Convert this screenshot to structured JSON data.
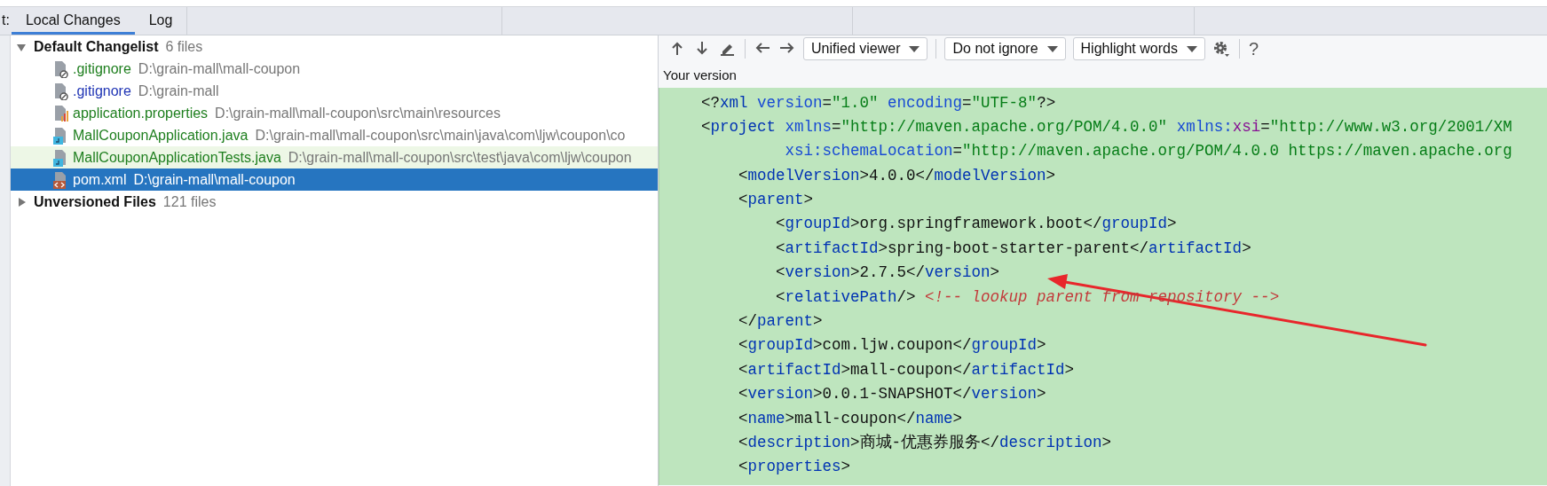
{
  "side_label": "t:",
  "tabs": [
    {
      "label": "Local Changes",
      "selected": true
    },
    {
      "label": "Log",
      "selected": false
    }
  ],
  "tree": [
    {
      "label": "Default Changelist",
      "count": "6 files",
      "expanded": true,
      "children": [
        {
          "name": ".gitignore",
          "path": "D:\\grain-mall\\mall-coupon",
          "kind": "ignore",
          "color": "#1f7f1f",
          "selected": false,
          "highlighted": false
        },
        {
          "name": ".gitignore",
          "path": "D:\\grain-mall",
          "kind": "ignore",
          "color": "#2035b5",
          "selected": false,
          "highlighted": false
        },
        {
          "name": "application.properties",
          "path": "D:\\grain-mall\\mall-coupon\\src\\main\\resources",
          "kind": "properties",
          "color": "#1f7f1f",
          "selected": false,
          "highlighted": false
        },
        {
          "name": "MallCouponApplication.java",
          "path": "D:\\grain-mall\\mall-coupon\\src\\main\\java\\com\\ljw\\coupon\\co",
          "kind": "java",
          "color": "#1f7f1f",
          "selected": false,
          "highlighted": false
        },
        {
          "name": "MallCouponApplicationTests.java",
          "path": "D:\\grain-mall\\mall-coupon\\src\\test\\java\\com\\ljw\\coupon",
          "kind": "java",
          "color": "#1f7f1f",
          "selected": false,
          "highlighted": true
        },
        {
          "name": "pom.xml",
          "path": "D:\\grain-mall\\mall-coupon",
          "kind": "xml",
          "selected": true,
          "highlighted": false
        }
      ]
    },
    {
      "label": "Unversioned Files",
      "count": "121 files",
      "expanded": false
    }
  ],
  "toolbar": [
    {
      "kind": "up"
    },
    {
      "kind": "down"
    },
    {
      "kind": "edit"
    },
    {
      "kind": "separator"
    },
    {
      "kind": "left"
    },
    {
      "kind": "right"
    },
    {
      "kind": "dropdown",
      "label": "Unified viewer"
    },
    {
      "kind": "separator"
    },
    {
      "kind": "dropdown",
      "label": "Do not ignore"
    },
    {
      "kind": "dropdown",
      "label": "Highlight words"
    },
    {
      "kind": "gear"
    },
    {
      "kind": "separator"
    },
    {
      "kind": "text",
      "label": "?"
    }
  ],
  "version_label": "Your version",
  "code_lines": [
    [
      {
        "kind": "plain",
        "text": "<?"
      },
      {
        "kind": "tag",
        "text": "xml"
      },
      {
        "kind": "attr",
        "text": " version"
      },
      {
        "kind": "plain",
        "text": "="
      },
      {
        "kind": "value",
        "text": "\"1.0\""
      },
      {
        "kind": "attr",
        "text": " encoding"
      },
      {
        "kind": "plain",
        "text": "="
      },
      {
        "kind": "value",
        "text": "\"UTF-8\""
      },
      {
        "kind": "plain",
        "text": "?>"
      }
    ],
    [
      {
        "kind": "plain",
        "text": "<"
      },
      {
        "kind": "tag",
        "text": "project"
      },
      {
        "kind": "attr",
        "text": " xmlns"
      },
      {
        "kind": "plain",
        "text": "="
      },
      {
        "kind": "value",
        "text": "\"http://maven.apache.org/POM/4.0.0\""
      },
      {
        "kind": "attr",
        "text": " xmlns:"
      },
      {
        "kind": "ns",
        "text": "xsi"
      },
      {
        "kind": "plain",
        "text": "="
      },
      {
        "kind": "value",
        "text": "\"http://www.w3.org/2001/XM"
      }
    ],
    [
      {
        "kind": "attr",
        "text": "         xsi:schemaLocation"
      },
      {
        "kind": "plain",
        "text": "="
      },
      {
        "kind": "value",
        "text": "\"http://maven.apache.org/POM/4.0.0 https://maven.apache.org"
      }
    ],
    [
      {
        "kind": "plain",
        "text": "    <"
      },
      {
        "kind": "tag",
        "text": "modelVersion"
      },
      {
        "kind": "plain",
        "text": ">4.0.0</"
      },
      {
        "kind": "tag",
        "text": "modelVersion"
      },
      {
        "kind": "plain",
        "text": ">"
      }
    ],
    [
      {
        "kind": "plain",
        "text": "    <"
      },
      {
        "kind": "tag",
        "text": "parent"
      },
      {
        "kind": "plain",
        "text": ">"
      }
    ],
    [
      {
        "kind": "plain",
        "text": "        <"
      },
      {
        "kind": "tag",
        "text": "groupId"
      },
      {
        "kind": "plain",
        "text": ">org.springframework.boot</"
      },
      {
        "kind": "tag",
        "text": "groupId"
      },
      {
        "kind": "plain",
        "text": ">"
      }
    ],
    [
      {
        "kind": "plain",
        "text": "        <"
      },
      {
        "kind": "tag",
        "text": "artifactId"
      },
      {
        "kind": "plain",
        "text": ">spring-boot-starter-parent</"
      },
      {
        "kind": "tag",
        "text": "artifactId"
      },
      {
        "kind": "plain",
        "text": ">"
      }
    ],
    [
      {
        "kind": "plain",
        "text": "        <"
      },
      {
        "kind": "tag",
        "text": "version"
      },
      {
        "kind": "plain",
        "text": ">2.7.5</"
      },
      {
        "kind": "tag",
        "text": "version"
      },
      {
        "kind": "plain",
        "text": ">"
      }
    ],
    [
      {
        "kind": "plain",
        "text": "        <"
      },
      {
        "kind": "tag",
        "text": "relativePath"
      },
      {
        "kind": "plain",
        "text": "/> "
      },
      {
        "kind": "comment",
        "text": "<!-- lookup parent from repository -->"
      }
    ],
    [
      {
        "kind": "plain",
        "text": "    </"
      },
      {
        "kind": "tag",
        "text": "parent"
      },
      {
        "kind": "plain",
        "text": ">"
      }
    ],
    [
      {
        "kind": "plain",
        "text": "    <"
      },
      {
        "kind": "tag",
        "text": "groupId"
      },
      {
        "kind": "plain",
        "text": ">com.ljw.coupon</"
      },
      {
        "kind": "tag",
        "text": "groupId"
      },
      {
        "kind": "plain",
        "text": ">"
      }
    ],
    [
      {
        "kind": "plain",
        "text": "    <"
      },
      {
        "kind": "tag",
        "text": "artifactId"
      },
      {
        "kind": "plain",
        "text": ">mall-coupon</"
      },
      {
        "kind": "tag",
        "text": "artifactId"
      },
      {
        "kind": "plain",
        "text": ">"
      }
    ],
    [
      {
        "kind": "plain",
        "text": "    <"
      },
      {
        "kind": "tag",
        "text": "version"
      },
      {
        "kind": "plain",
        "text": ">0.0.1-SNAPSHOT</"
      },
      {
        "kind": "tag",
        "text": "version"
      },
      {
        "kind": "plain",
        "text": ">"
      }
    ],
    [
      {
        "kind": "plain",
        "text": "    <"
      },
      {
        "kind": "tag",
        "text": "name"
      },
      {
        "kind": "plain",
        "text": ">mall-coupon</"
      },
      {
        "kind": "tag",
        "text": "name"
      },
      {
        "kind": "plain",
        "text": ">"
      }
    ],
    [
      {
        "kind": "plain",
        "text": "    <"
      },
      {
        "kind": "tag",
        "text": "description"
      },
      {
        "kind": "plain",
        "text": ">商城-优惠券服务</"
      },
      {
        "kind": "tag",
        "text": "description"
      },
      {
        "kind": "plain",
        "text": ">"
      }
    ],
    [
      {
        "kind": "plain",
        "text": "    <"
      },
      {
        "kind": "tag",
        "text": "properties"
      },
      {
        "kind": "plain",
        "text": ">"
      }
    ]
  ]
}
